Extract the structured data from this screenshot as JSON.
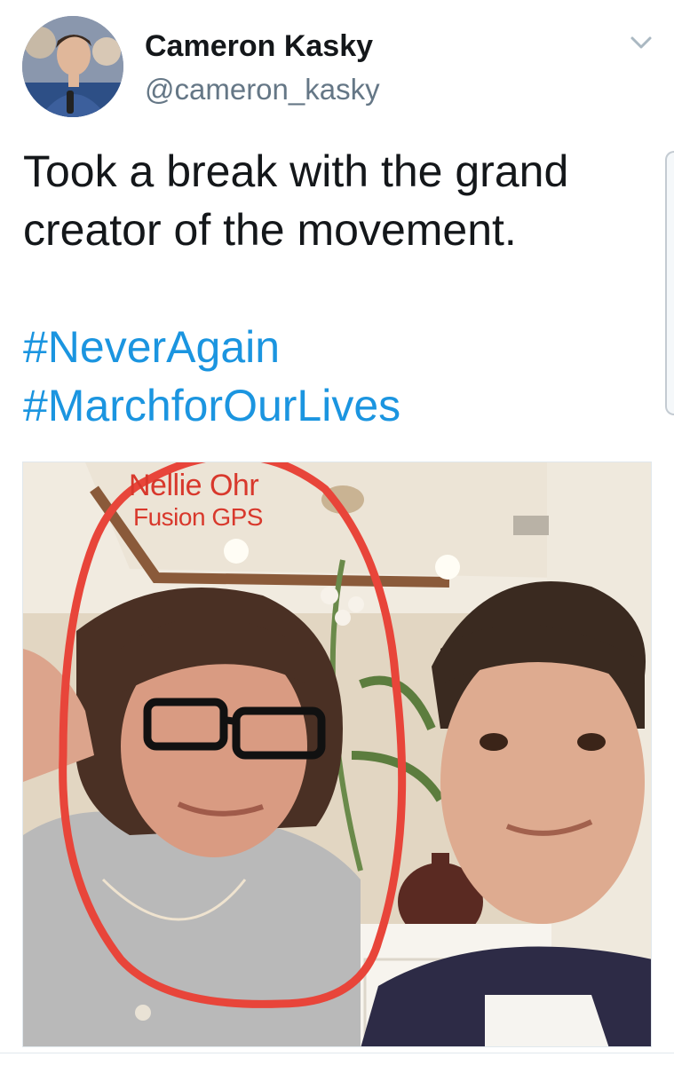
{
  "tweet": {
    "author": {
      "display_name": "Cameron Kasky",
      "handle": "@cameron_kasky"
    },
    "text_lines": [
      "Took a break with the grand",
      "creator of the movement."
    ],
    "hashtags": [
      "#NeverAgain",
      "#MarchforOurLives"
    ],
    "menu_icon": "chevron-down-icon"
  },
  "photo": {
    "annotation": {
      "name": "Nellie Ohr",
      "organization": "Fusion GPS",
      "color": "#d8382c"
    }
  },
  "colors": {
    "text": "#14171a",
    "secondary_text": "#657786",
    "link": "#1b95e0"
  }
}
